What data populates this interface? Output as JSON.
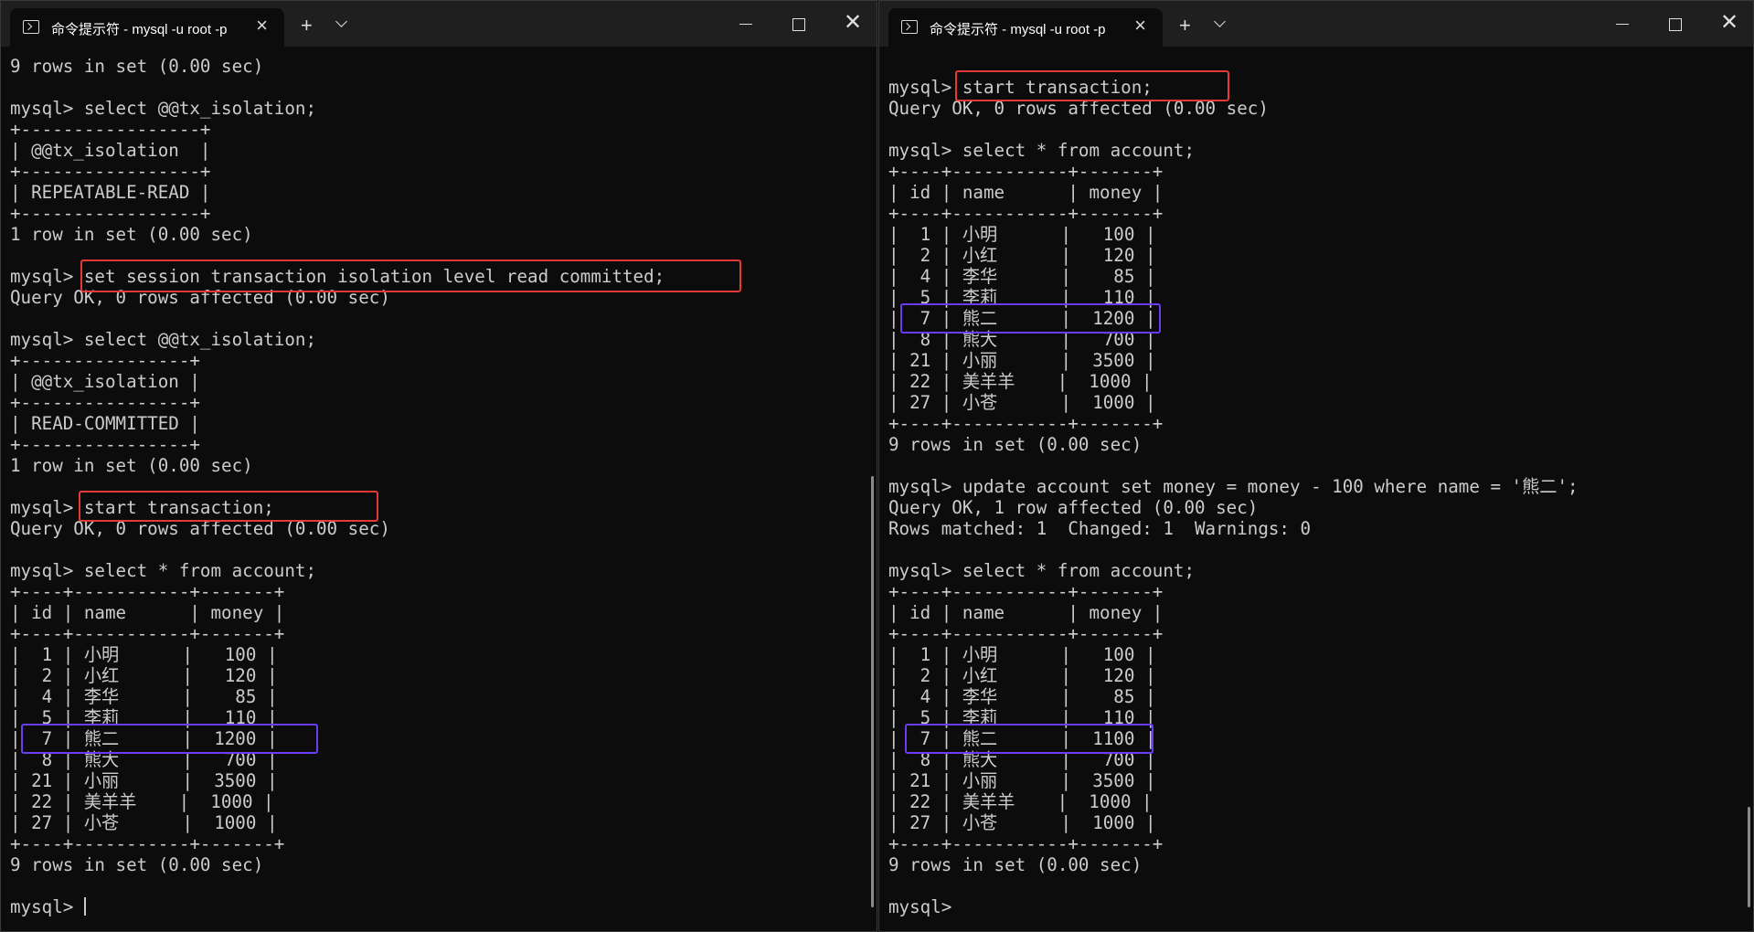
{
  "colors": {
    "background": "#0c0c0c",
    "titlebar": "#1f1f1f",
    "text": "#cccccc",
    "highlight_red": "#e53935",
    "highlight_purple": "#6a3df5"
  },
  "icons": [
    "terminal-icon",
    "close-icon",
    "plus-icon",
    "chevron-down-icon",
    "minimize-icon",
    "maximize-icon",
    "window-close-icon"
  ],
  "left_window": {
    "tab_title": "命令提示符 - mysql  -u root -p",
    "tab_close": "×",
    "new_tab": "+",
    "close_symbol": "✕",
    "lines": [
      "9 rows in set (0.00 sec)",
      "",
      "mysql> select @@tx_isolation;",
      "+-----------------+",
      "| @@tx_isolation  |",
      "+-----------------+",
      "| REPEATABLE-READ |",
      "+-----------------+",
      "1 row in set (0.00 sec)",
      "",
      "mysql> set session transaction isolation level read committed;",
      "Query OK, 0 rows affected (0.00 sec)",
      "",
      "mysql> select @@tx_isolation;",
      "+----------------+",
      "| @@tx_isolation |",
      "+----------------+",
      "| READ-COMMITTED |",
      "+----------------+",
      "1 row in set (0.00 sec)",
      "",
      "mysql> start transaction;",
      "Query OK, 0 rows affected (0.00 sec)",
      "",
      "mysql> select * from account;",
      "+----+-----------+-------+",
      "| id | name      | money |",
      "+----+-----------+-------+",
      "|  1 | 小明      |   100 |",
      "|  2 | 小红      |   120 |",
      "|  4 | 李华      |    85 |",
      "|  5 | 李莉      |   110 |",
      "|  7 | 熊二      |  1200 |",
      "|  8 | 熊大      |   700 |",
      "| 21 | 小丽      |  3500 |",
      "| 22 | 美羊羊    |  1000 |",
      "| 27 | 小苍      |  1000 |",
      "+----+-----------+-------+",
      "9 rows in set (0.00 sec)",
      "",
      "mysql> "
    ]
  },
  "right_window": {
    "tab_title": "命令提示符 - mysql  -u root -p",
    "tab_close": "×",
    "new_tab": "+",
    "close_symbol": "✕",
    "lines": [
      "",
      "mysql> start transaction;",
      "Query OK, 0 rows affected (0.00 sec)",
      "",
      "mysql> select * from account;",
      "+----+-----------+-------+",
      "| id | name      | money |",
      "+----+-----------+-------+",
      "|  1 | 小明      |   100 |",
      "|  2 | 小红      |   120 |",
      "|  4 | 李华      |    85 |",
      "|  5 | 李莉      |   110 |",
      "|  7 | 熊二      |  1200 |",
      "|  8 | 熊大      |   700 |",
      "| 21 | 小丽      |  3500 |",
      "| 22 | 美羊羊    |  1000 |",
      "| 27 | 小苍      |  1000 |",
      "+----+-----------+-------+",
      "9 rows in set (0.00 sec)",
      "",
      "mysql> update account set money = money - 100 where name = '熊二';",
      "Query OK, 1 row affected (0.00 sec)",
      "Rows matched: 1  Changed: 1  Warnings: 0",
      "",
      "mysql> select * from account;",
      "+----+-----------+-------+",
      "| id | name      | money |",
      "+----+-----------+-------+",
      "|  1 | 小明      |   100 |",
      "|  2 | 小红      |   120 |",
      "|  4 | 李华      |    85 |",
      "|  5 | 李莉      |   110 |",
      "|  7 | 熊二      |  1100 |",
      "|  8 | 熊大      |   700 |",
      "| 21 | 小丽      |  3500 |",
      "| 22 | 美羊羊    |  1000 |",
      "| 27 | 小苍      |  1000 |",
      "+----+-----------+-------+",
      "9 rows in set (0.00 sec)",
      "",
      "mysql> "
    ]
  }
}
